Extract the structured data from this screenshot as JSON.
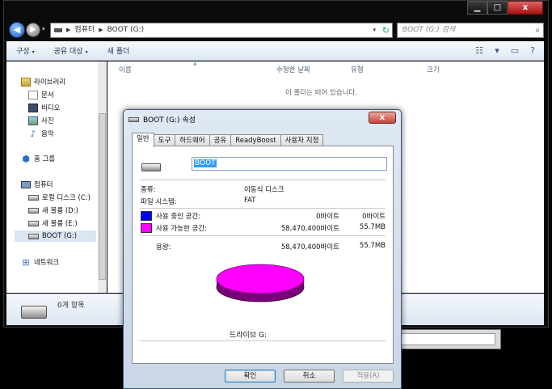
{
  "explorer": {
    "caption": {
      "minimize": "▁",
      "maximize": "□",
      "close": "x"
    },
    "address": {
      "root": "컴퓨터",
      "current": "BOOT (G:)",
      "history_arrow": "▾",
      "dropdown": "▾",
      "refresh": "↻"
    },
    "search_placeholder": "BOOT (G:) 검색",
    "toolbar": {
      "organize": "구성",
      "share_with": "공유 대상",
      "new_folder": "새 폴더",
      "dropdown_arrow": "▾"
    },
    "nav": {
      "libraries": "라이브러리",
      "documents": "문서",
      "videos": "비디오",
      "pictures": "사진",
      "music": "음악",
      "homegroup": "홈 그룹",
      "computer": "컴퓨터",
      "local_disk": "로컬 디스크 (C:)",
      "new_volume_d": "새 볼륨 (D:)",
      "new_volume_e": "새 볼륨 (E:)",
      "boot_drive": "BOOT (G:)",
      "network": "네트워크"
    },
    "columns": {
      "name": "이름",
      "modified": "수정한 날짜",
      "type": "유형",
      "size": "크기"
    },
    "empty_message": "이 폴더는 비어 있습니다.",
    "item_count": "0개 항목"
  },
  "dialog": {
    "title": "BOOT (G:) 속성",
    "close": "x",
    "tabs": [
      "일반",
      "도구",
      "하드웨어",
      "공유",
      "ReadyBoost",
      "사용자 지정"
    ],
    "volume_name": "BOOT",
    "type_label": "종류:",
    "type_value": "이동식 디스크",
    "fs_label": "파일 시스템:",
    "fs_value": "FAT",
    "used_label": "사용 중인 공간:",
    "used_bytes": "0바이트",
    "used_size": "0바이트",
    "free_label": "사용 가능한 공간:",
    "free_bytes": "58,470,400바이트",
    "free_size": "55.7MB",
    "capacity_label": "용량:",
    "capacity_bytes": "58,470,400바이트",
    "capacity_size": "55.7MB",
    "drive_label": "드라이브 G:",
    "free_fraction": 1.0,
    "used_color": "#0000ff",
    "free_color": "#ff00ff",
    "buttons": {
      "ok": "확인",
      "cancel": "취소",
      "apply": "적용(A)"
    }
  }
}
